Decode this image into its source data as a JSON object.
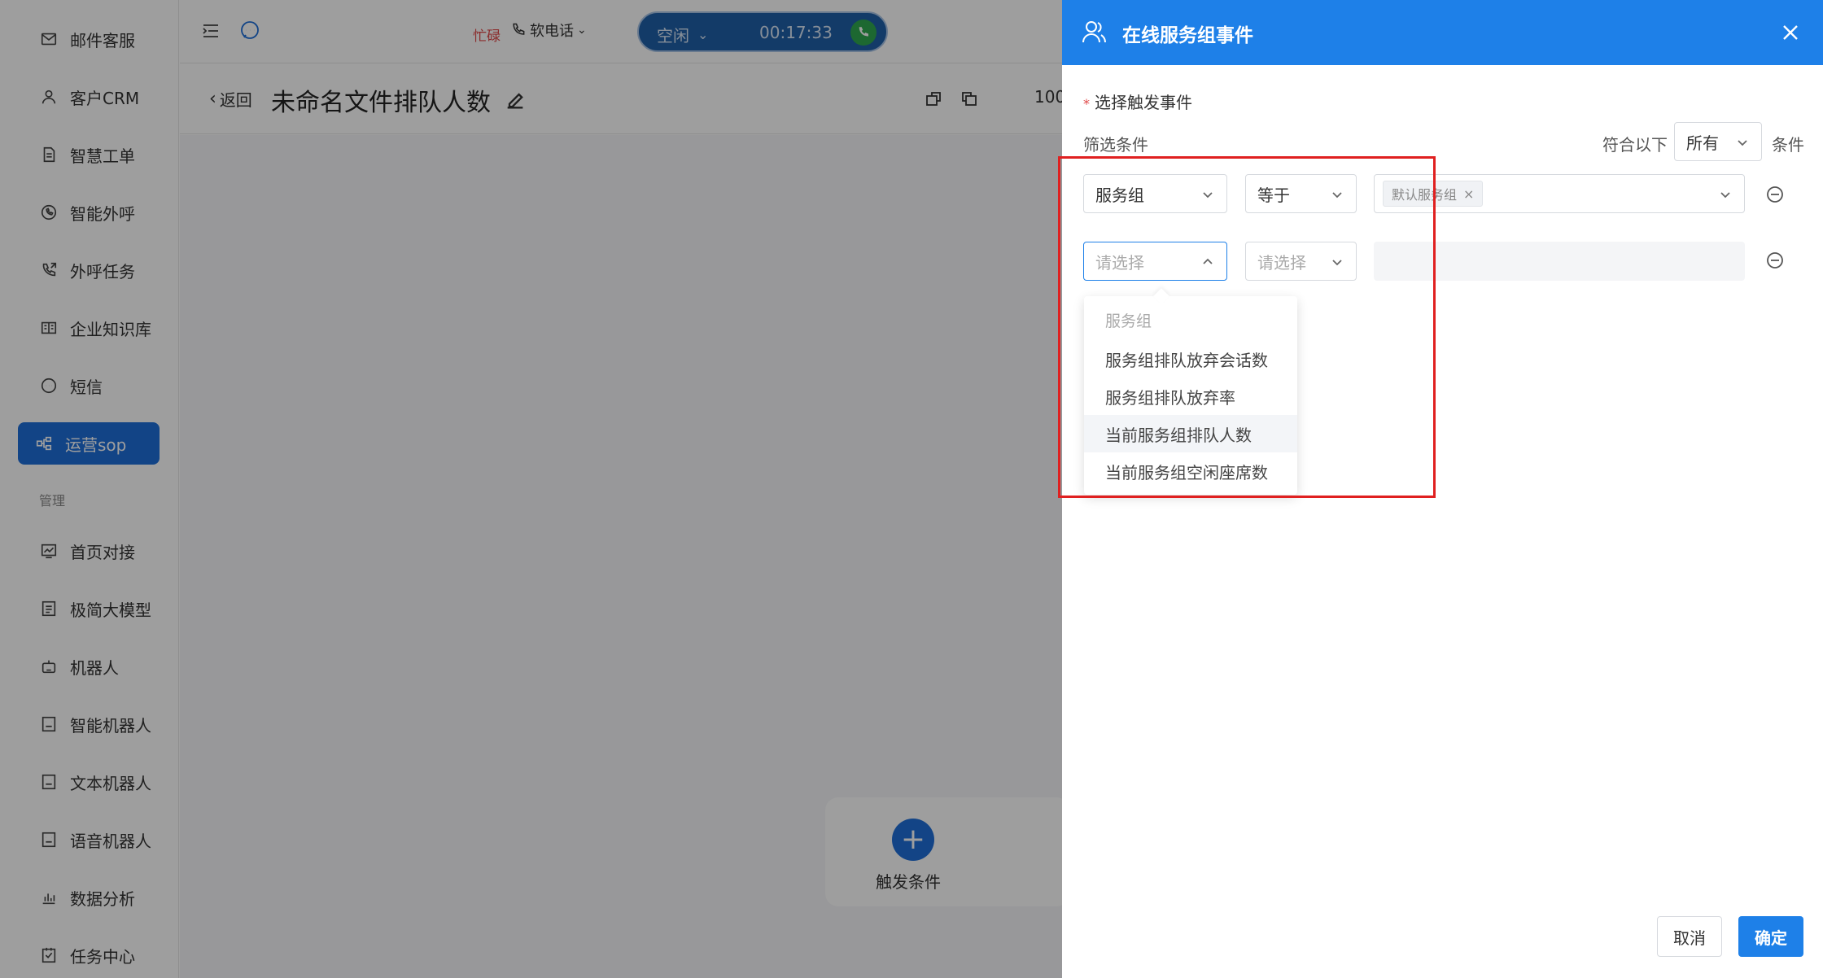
{
  "sidebar": {
    "items": [
      {
        "label": "邮件客服",
        "icon": "mail-icon"
      },
      {
        "label": "客户CRM",
        "icon": "user-icon"
      },
      {
        "label": "智慧工单",
        "icon": "document-icon"
      },
      {
        "label": "智能外呼",
        "icon": "whatsapp-icon"
      },
      {
        "label": "外呼任务",
        "icon": "phone-outgoing-icon"
      },
      {
        "label": "企业知识库",
        "icon": "book-icon"
      },
      {
        "label": "短信",
        "icon": "sms-icon"
      },
      {
        "label": "运营sop",
        "icon": "flow-icon"
      }
    ],
    "section_label": "管理",
    "manage_items": [
      {
        "label": "首页对接",
        "icon": "chart-icon"
      },
      {
        "label": "极简大模型",
        "icon": "model-icon"
      },
      {
        "label": "机器人",
        "icon": "robot-icon"
      },
      {
        "label": "智能机器人",
        "icon": "bot-icon"
      },
      {
        "label": "文本机器人",
        "icon": "text-bot-icon"
      },
      {
        "label": "语音机器人",
        "icon": "voice-bot-icon"
      },
      {
        "label": "数据分析",
        "icon": "bar-chart-icon"
      },
      {
        "label": "任务中心",
        "icon": "task-icon"
      }
    ]
  },
  "topbar": {
    "busy_label": "忙碌",
    "softphone_label": "软电话",
    "call_status": "空闲",
    "call_timer": "00:17:33"
  },
  "page": {
    "back_label": "返回",
    "title": "未命名文件排队人数",
    "zoom": "100"
  },
  "canvas": {
    "trigger_label": "触发条件"
  },
  "drawer": {
    "title": "在线服务组事件",
    "required_label": "选择触发事件",
    "filter_label": "筛选条件",
    "match_prefix": "符合以下",
    "match_value": "所有",
    "match_suffix": "条件",
    "row1": {
      "field": "服务组",
      "operator": "等于",
      "value_tag": "默认服务组"
    },
    "row2": {
      "field_placeholder": "请选择",
      "operator_placeholder": "请选择"
    },
    "dropdown": {
      "group_label": "服务组",
      "options": [
        "服务组排队放弃会话数",
        "服务组排队放弃率",
        "当前服务组排队人数",
        "当前服务组空闲座席数"
      ]
    },
    "cancel_label": "取消",
    "ok_label": "确定"
  },
  "colors": {
    "primary": "#1e80e8",
    "sidebar_active": "#1e6fd9",
    "busy": "#e04848",
    "highlight": "#e02020"
  }
}
